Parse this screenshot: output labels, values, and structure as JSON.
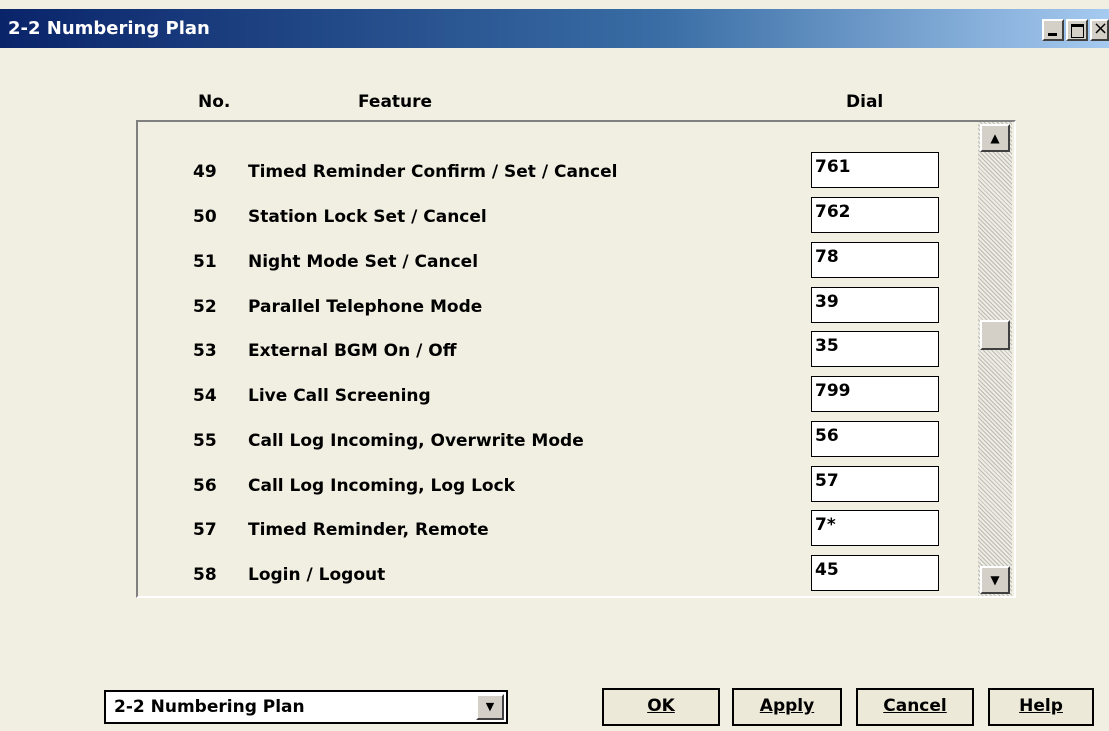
{
  "window": {
    "title": "2-2 Numbering Plan"
  },
  "columns": {
    "no": "No.",
    "feature": "Feature",
    "dial": "Dial"
  },
  "rows": [
    {
      "no": "49",
      "feature": "Timed Reminder Confirm / Set / Cancel",
      "dial": "761"
    },
    {
      "no": "50",
      "feature": "Station Lock Set / Cancel",
      "dial": "762"
    },
    {
      "no": "51",
      "feature": "Night Mode Set / Cancel",
      "dial": "78"
    },
    {
      "no": "52",
      "feature": "Parallel Telephone Mode",
      "dial": "39"
    },
    {
      "no": "53",
      "feature": "External BGM On / Off",
      "dial": "35"
    },
    {
      "no": "54",
      "feature": "Live Call Screening",
      "dial": "799"
    },
    {
      "no": "55",
      "feature": "Call Log Incoming, Overwrite Mode",
      "dial": "56"
    },
    {
      "no": "56",
      "feature": "Call Log Incoming, Log Lock",
      "dial": "57"
    },
    {
      "no": "57",
      "feature": "Timed Reminder, Remote",
      "dial": "7*"
    },
    {
      "no": "58",
      "feature": "Login / Logout",
      "dial": "45"
    }
  ],
  "footer": {
    "page_select": "2-2 Numbering Plan",
    "ok": "OK",
    "apply": "Apply",
    "cancel": "Cancel",
    "help": "Help"
  }
}
